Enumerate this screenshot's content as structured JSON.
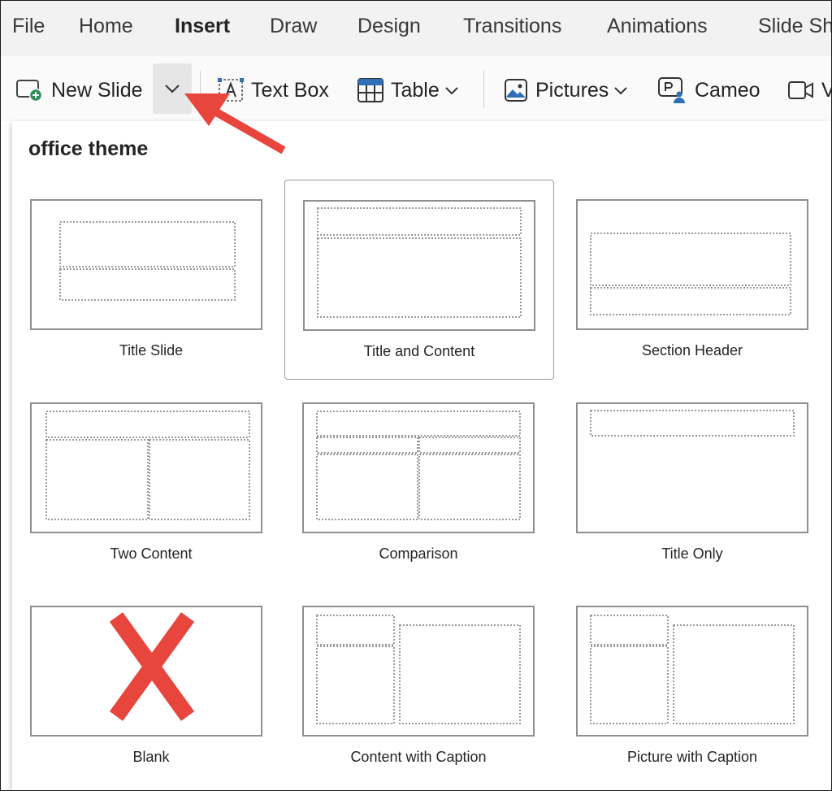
{
  "menu": {
    "tabs": [
      {
        "label": "File"
      },
      {
        "label": "Home"
      },
      {
        "label": "Insert"
      },
      {
        "label": "Draw"
      },
      {
        "label": "Design"
      },
      {
        "label": "Transitions"
      },
      {
        "label": "Animations"
      },
      {
        "label": "Slide Sh"
      }
    ],
    "active_tab": "Insert"
  },
  "ribbon": {
    "new_slide": "New Slide",
    "text_box": "Text Box",
    "table": "Table",
    "pictures": "Pictures",
    "cameo": "Cameo",
    "video": "V"
  },
  "panel": {
    "section_title": "office theme",
    "layouts": [
      {
        "label": "Title Slide"
      },
      {
        "label": "Title and Content",
        "selected": true
      },
      {
        "label": "Section Header"
      },
      {
        "label": "Two Content"
      },
      {
        "label": "Comparison"
      },
      {
        "label": "Title Only"
      },
      {
        "label": "Blank"
      },
      {
        "label": "Content with Caption"
      },
      {
        "label": "Picture with Caption"
      }
    ]
  },
  "colors": {
    "annotation_red": "#e8453c",
    "icon_green": "#2e8b57",
    "icon_blue": "#2f6fb5",
    "menubar_bg": "#f2f2f2"
  }
}
